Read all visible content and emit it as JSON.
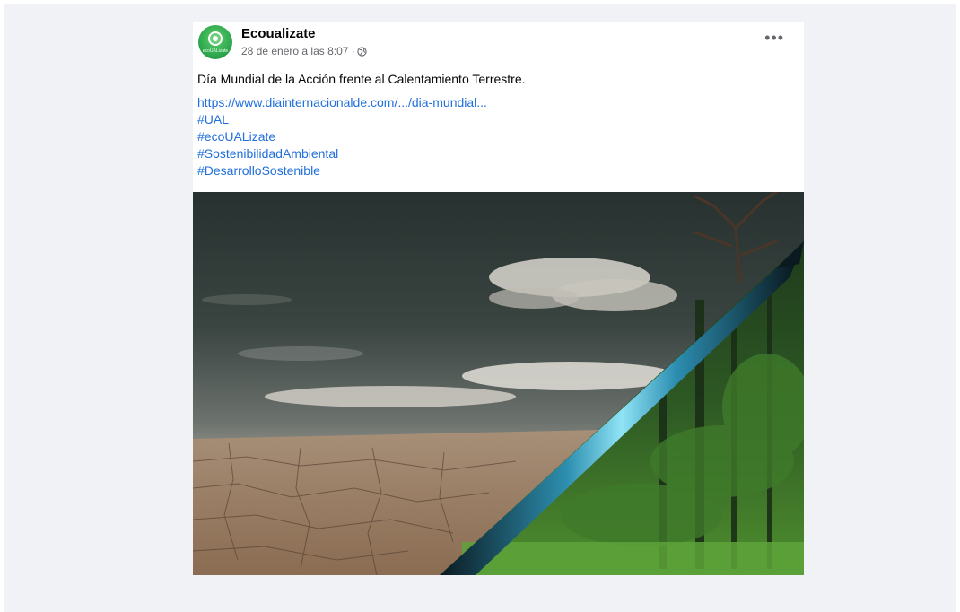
{
  "post": {
    "page_name": "Ecoualizate",
    "avatar_caption": "ecoUALizate",
    "timestamp": "28 de enero a las 8:07 ·",
    "privacy_icon": "globe-icon",
    "more_label": "•••",
    "text": "Día Mundial de la Acción frente al Calentamiento Terrestre.",
    "link": "https://www.diainternacionalde.com/.../dia-mundial...",
    "hashtags": [
      "#UAL",
      "#ecoUALizate",
      "#SostenibilidadAmbiental",
      "#DesarrolloSostenible"
    ]
  },
  "colors": {
    "background": "#f0f2f5",
    "card": "#ffffff",
    "link": "#216fdb",
    "avatar": "#2fa84f"
  }
}
